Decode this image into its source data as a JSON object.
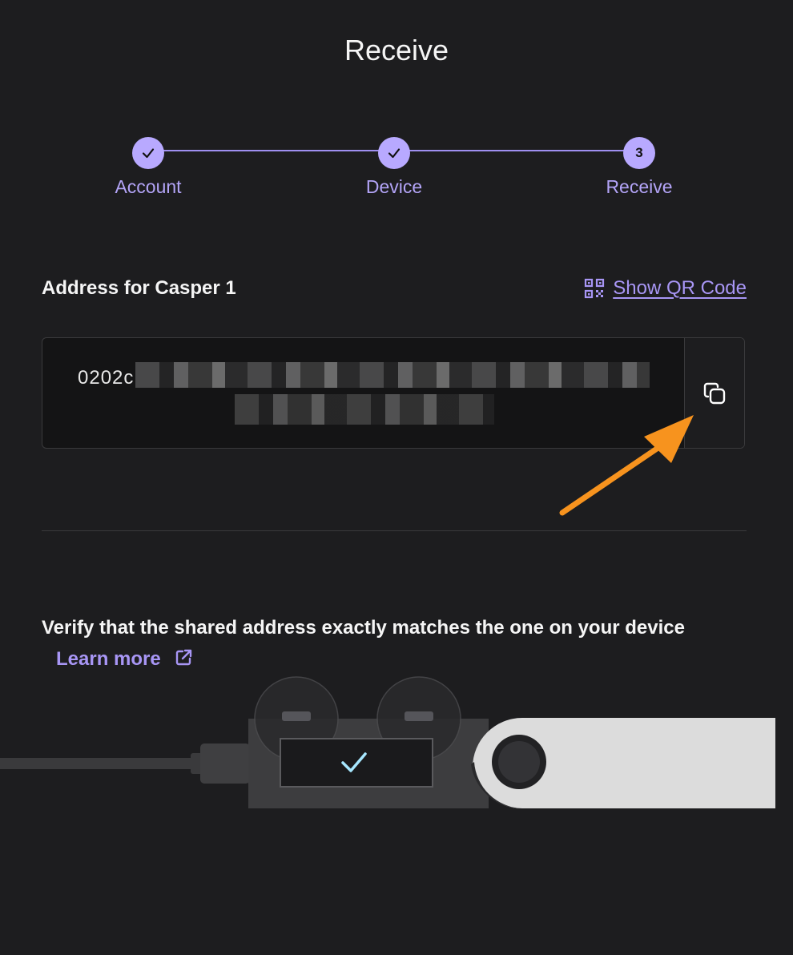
{
  "header": {
    "title": "Receive"
  },
  "stepper": {
    "steps": [
      {
        "label": "Account",
        "status": "done"
      },
      {
        "label": "Device",
        "status": "done"
      },
      {
        "label": "Receive",
        "status": "current",
        "number": "3"
      }
    ]
  },
  "address": {
    "label": "Address for Casper 1",
    "show_qr_label": "Show QR Code",
    "value_visible_prefix": "0202c"
  },
  "verify": {
    "text": "Verify that the shared address exactly matches the one on your device",
    "learn_more": "Learn more"
  },
  "colors": {
    "accent": "#b8a9ff",
    "link": "#a896f5",
    "annotation_arrow": "#f7931e",
    "background": "#1d1d1f"
  },
  "icons": [
    "check-icon",
    "qr-code-icon",
    "copy-icon",
    "external-link-icon",
    "check-icon"
  ]
}
